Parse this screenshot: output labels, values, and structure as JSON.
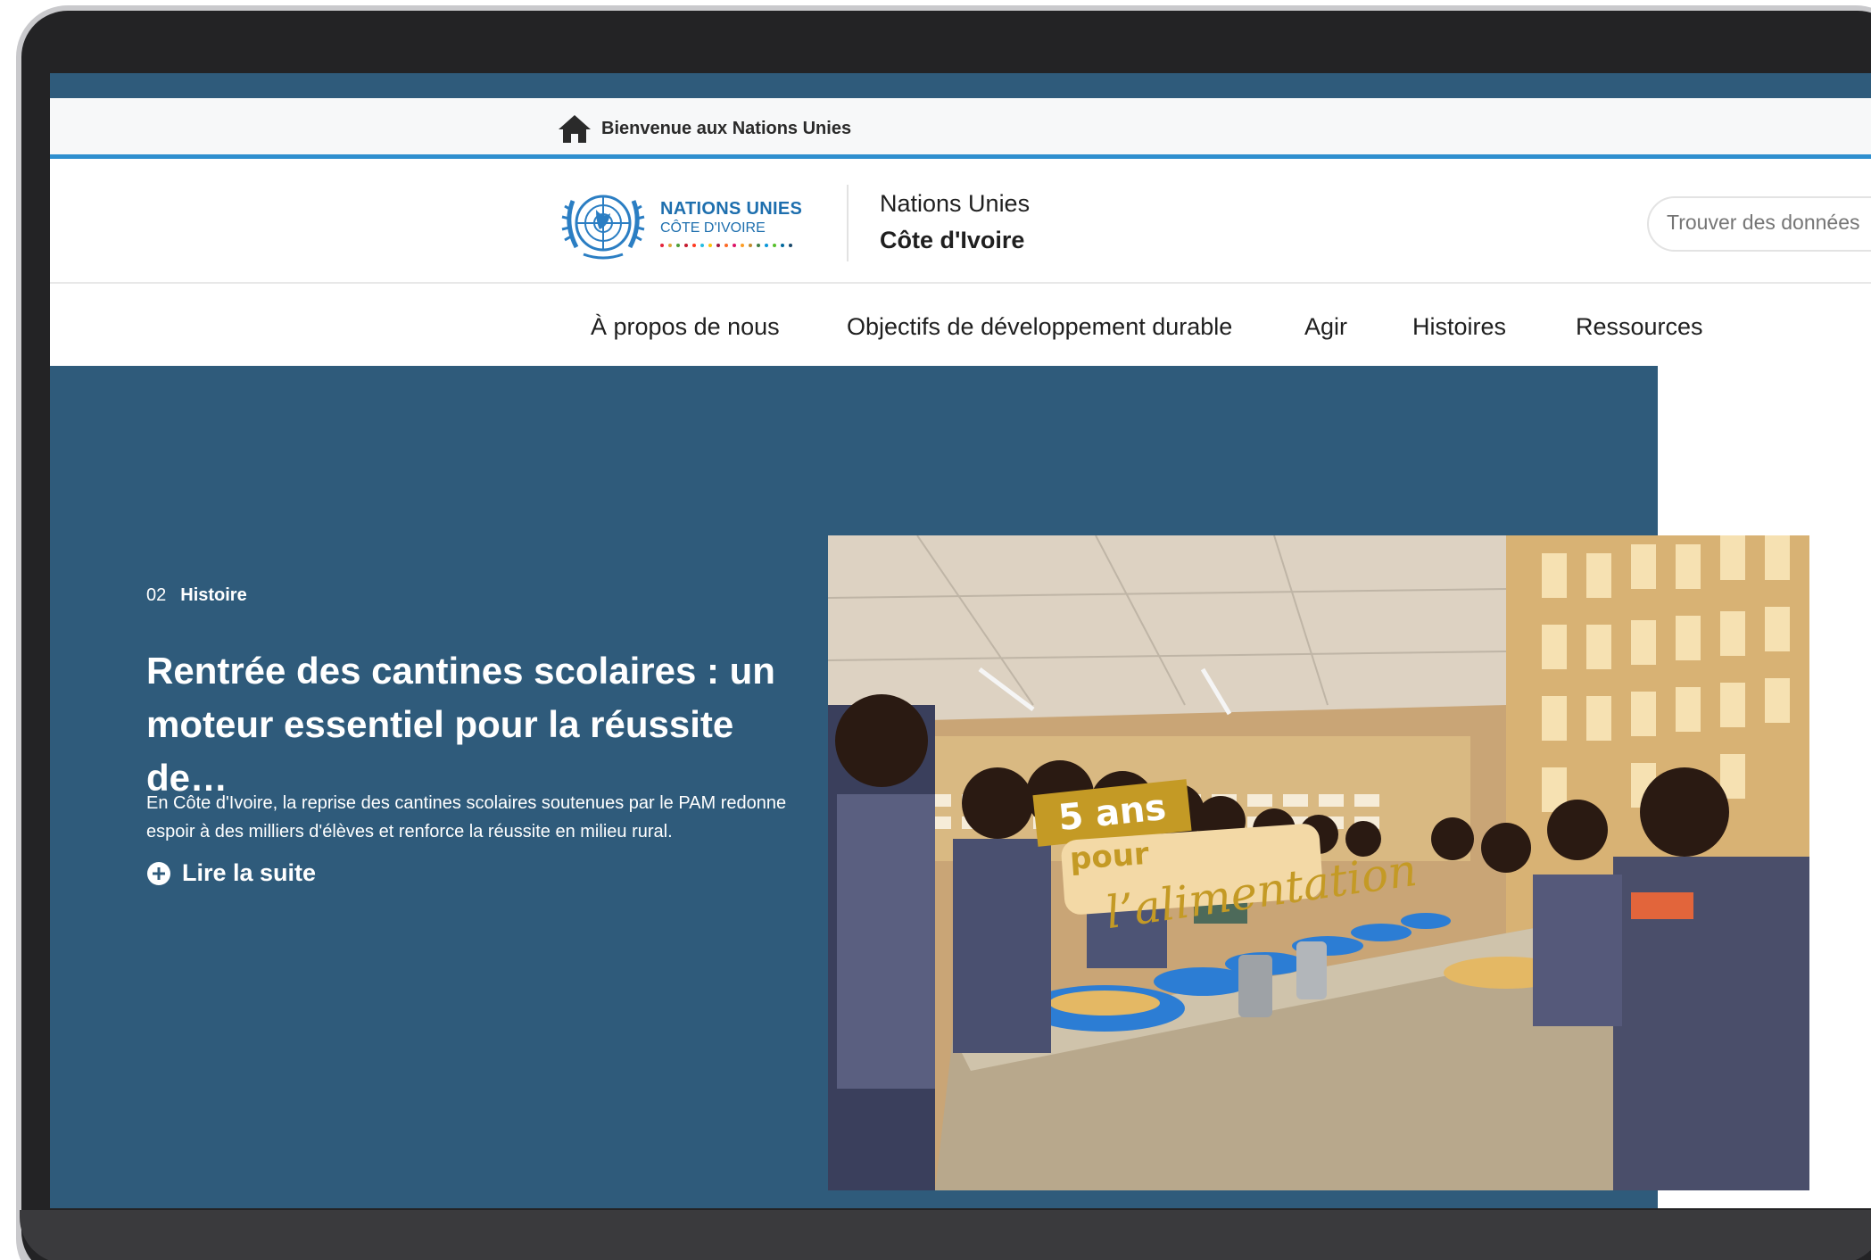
{
  "topbar": {
    "welcome_label": "Bienvenue aux Nations Unies"
  },
  "header": {
    "logo_main": "NATIONS UNIES",
    "logo_sub": "CÔTE D'IVOIRE",
    "site_title_line1": "Nations Unies",
    "site_title_line2": "Côte d'Ivoire"
  },
  "search": {
    "placeholder": "Trouver des données"
  },
  "nav": {
    "items": [
      {
        "label": "À propos de nous"
      },
      {
        "label": "Objectifs de développement durable"
      },
      {
        "label": "Agir"
      },
      {
        "label": "Histoires"
      },
      {
        "label": "Ressources"
      }
    ]
  },
  "hero": {
    "index": "02",
    "category": "Histoire",
    "headline": "Rentrée des cantines scolaires : un moteur essentiel pour la réussite de…",
    "summary": "En Côte d'Ivoire, la reprise des cantines scolaires soutenues par le PAM redonne espoir à des milliers d'élèves et renforce la réussite en milieu rural.",
    "read_more": "Lire la suite"
  },
  "photo_overlay": {
    "years": "5 ans",
    "pour": "pour",
    "theme": "l’alimentation"
  },
  "icons": {
    "home": "home-icon",
    "read_more": "plus-circle-icon",
    "emblem": "un-emblem-icon"
  },
  "colors": {
    "hero_bg": "#2f5b7b",
    "accent_blue": "#2f8fcf",
    "logo_blue": "#1e6fae",
    "badge_gold": "#c49a25"
  }
}
